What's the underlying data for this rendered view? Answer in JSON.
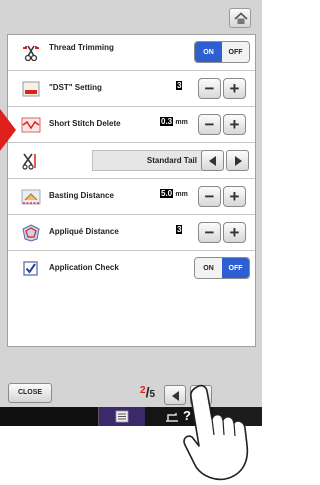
{
  "header": {
    "home_icon": "home-icon"
  },
  "settings": [
    {
      "label": "Thread Trimming",
      "icon": "scissors-icon",
      "control": "toggle",
      "on_label": "ON",
      "off_label": "OFF",
      "state": "on"
    },
    {
      "label": "\"DST\" Setting",
      "icon": "dst-icon",
      "control": "stepper",
      "value": "3"
    },
    {
      "label": "Short Stitch Delete",
      "icon": "short-stitch-icon",
      "control": "stepper",
      "value": "0.3",
      "unit": "mm"
    },
    {
      "label": "",
      "icon": "tail-scissors-icon",
      "control": "select",
      "value": "Standard Tail"
    },
    {
      "label": "Basting Distance",
      "icon": "basting-icon",
      "control": "stepper",
      "value": "5.0",
      "unit": "mm"
    },
    {
      "label": "Appliqué Distance",
      "icon": "applique-icon",
      "control": "stepper",
      "value": "3"
    },
    {
      "label": "Application Check",
      "icon": "checkbox-icon",
      "control": "toggle",
      "on_label": "ON",
      "off_label": "OFF",
      "state": "off"
    }
  ],
  "footer": {
    "close_label": "CLOSE",
    "page_current": "2",
    "page_total": "5"
  },
  "colors": {
    "accent_blue": "#2d5fd1",
    "page_red": "#e0201b",
    "settings_tab": "#3a2a6b"
  }
}
